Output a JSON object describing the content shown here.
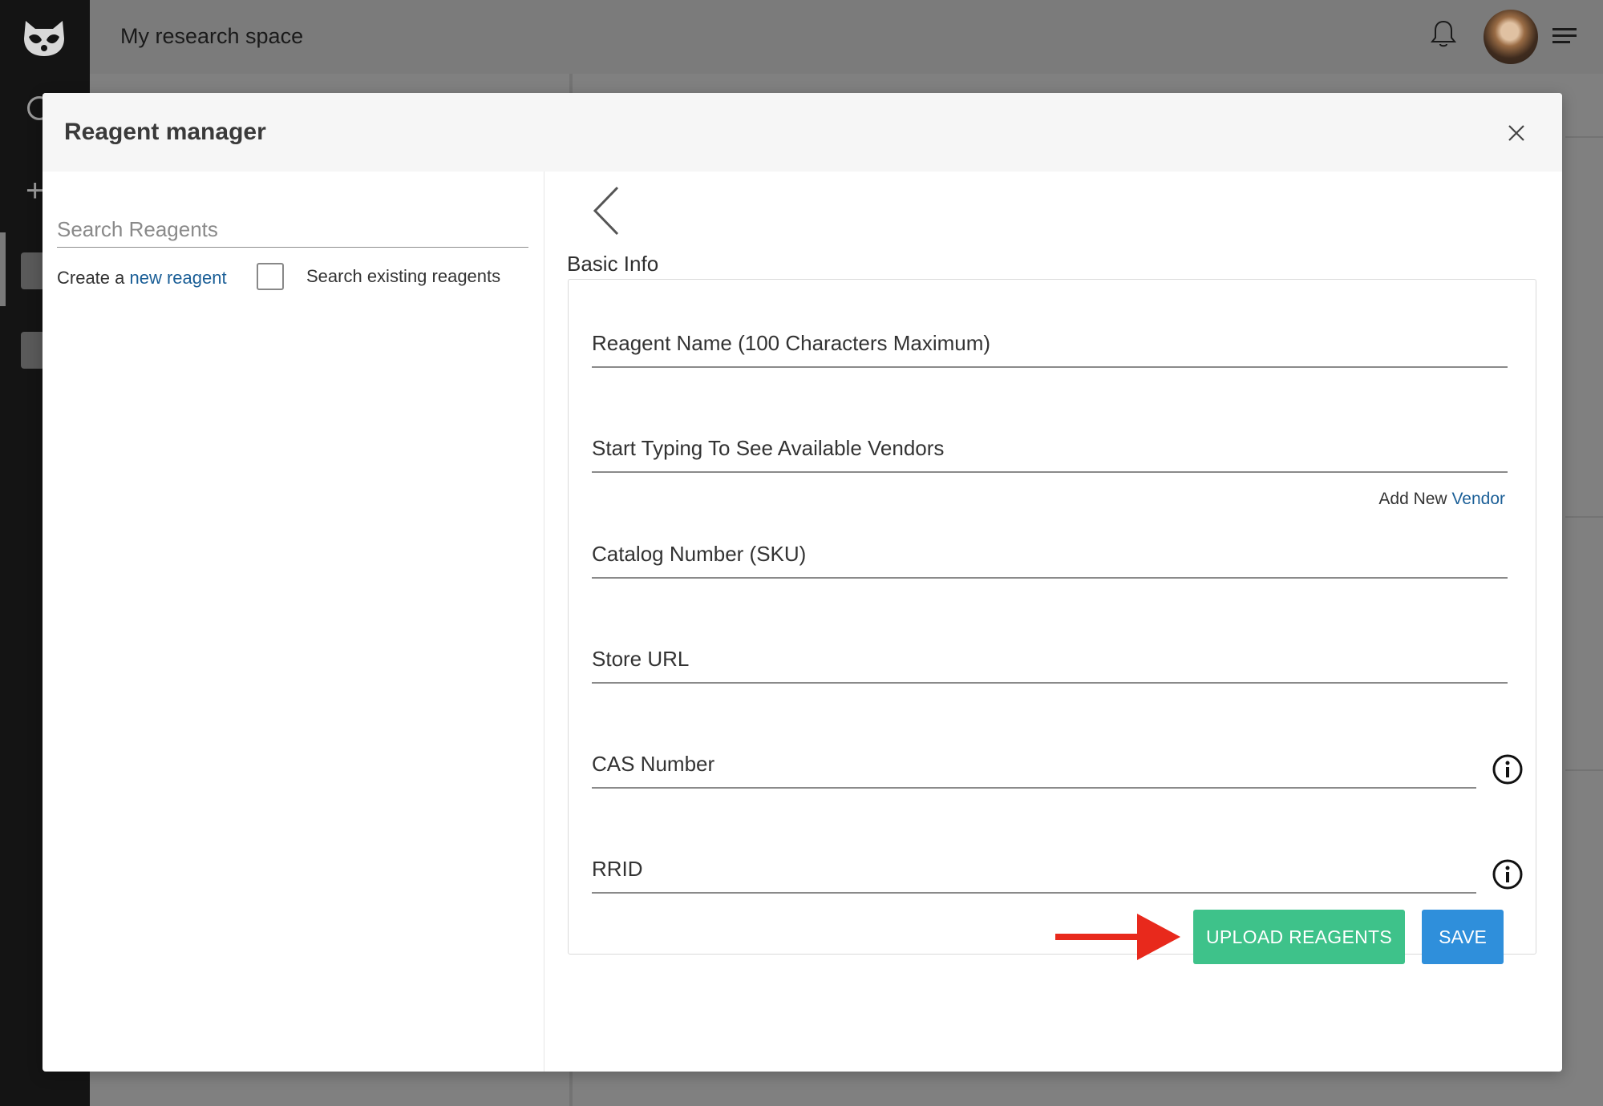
{
  "app": {
    "title": "My research space"
  },
  "modal": {
    "title": "Reagent manager"
  },
  "left_pane": {
    "search_placeholder": "Search Reagents",
    "create_prefix": "Create a ",
    "create_link": "new reagent",
    "search_existing_label": "Search existing reagents",
    "search_existing_checked": false
  },
  "right_pane": {
    "section_title": "Basic Info",
    "fields": {
      "reagent_name": "Reagent Name (100 Characters Maximum)",
      "vendor": "Start Typing To See Available Vendors",
      "catalog_number": "Catalog Number (SKU)",
      "store_url": "Store URL",
      "cas_number": "CAS Number",
      "rrid": "RRID"
    },
    "add_vendor_prefix": "Add New ",
    "add_vendor_link": "Vendor"
  },
  "actions": {
    "upload_label": "UPLOAD REAGENTS",
    "save_label": "SAVE"
  },
  "colors": {
    "upload_button": "#3ec28a",
    "save_button": "#2f8fdb",
    "link": "#1b5f97",
    "annotation_arrow": "#e8291c"
  },
  "icons": [
    "raccoon-logo-icon",
    "bell-icon",
    "hamburger-menu-icon",
    "close-icon",
    "chevron-left-icon",
    "info-icon",
    "red-arrow-icon"
  ]
}
